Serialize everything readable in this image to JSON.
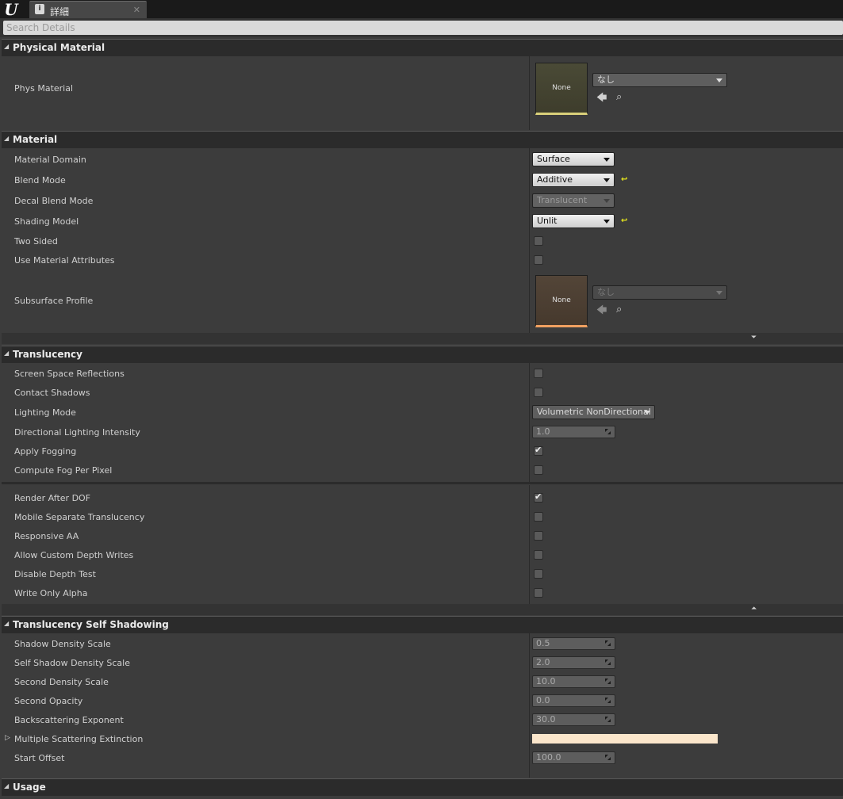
{
  "app": {
    "tab_label": "詳細",
    "tab_close": "✕",
    "logo": "U"
  },
  "search": {
    "placeholder": "Search Details"
  },
  "categories": {
    "physical_material": "Physical Material",
    "material": "Material",
    "translucency": "Translucency",
    "self_shadowing": "Translucency Self Shadowing",
    "usage": "Usage"
  },
  "physical_material": {
    "phys_material_label": "Phys Material",
    "thumb_text": "None",
    "asset_value": "なし"
  },
  "material": {
    "domain_label": "Material Domain",
    "domain_value": "Surface",
    "blend_label": "Blend Mode",
    "blend_value": "Additive",
    "decal_label": "Decal Blend Mode",
    "decal_value": "Translucent",
    "shading_label": "Shading Model",
    "shading_value": "Unlit",
    "two_sided_label": "Two Sided",
    "two_sided": false,
    "use_attr_label": "Use Material Attributes",
    "use_attr": false,
    "subsurface_label": "Subsurface Profile",
    "subsurface_thumb": "None",
    "subsurface_value": "なし"
  },
  "translucency": {
    "ssr_label": "Screen Space Reflections",
    "ssr": false,
    "contact_label": "Contact Shadows",
    "contact": false,
    "lighting_label": "Lighting Mode",
    "lighting_value": "Volumetric NonDirectional",
    "dir_label": "Directional Lighting Intensity",
    "dir_value": "1.0",
    "fog_label": "Apply Fogging",
    "fog": true,
    "fog_pp_label": "Compute Fog Per Pixel",
    "fog_pp": false,
    "after_dof_label": "Render After DOF",
    "after_dof": true,
    "mobile_sep_label": "Mobile Separate Translucency",
    "mobile_sep": false,
    "responsive_label": "Responsive AA",
    "responsive": false,
    "custom_depth_label": "Allow Custom Depth Writes",
    "custom_depth": false,
    "disable_depth_label": "Disable Depth Test",
    "disable_depth": false,
    "write_alpha_label": "Write Only Alpha",
    "write_alpha": false
  },
  "self_shadowing": {
    "shadow_density_label": "Shadow Density Scale",
    "shadow_density": "0.5",
    "self_shadow_label": "Self Shadow Density Scale",
    "self_shadow": "2.0",
    "second_density_label": "Second Density Scale",
    "second_density": "10.0",
    "second_opacity_label": "Second Opacity",
    "second_opacity": "0.0",
    "backscatter_label": "Backscattering Exponent",
    "backscatter": "30.0",
    "multi_scatter_label": "Multiple Scattering Extinction",
    "multi_scatter_color": "#fbe6cb",
    "start_offset_label": "Start Offset",
    "start_offset": "100.0"
  },
  "colors": {
    "reset_arrow": "#e5e51e",
    "panel_bg": "#3c3c3c",
    "header_bg": "#2b2b2b"
  }
}
